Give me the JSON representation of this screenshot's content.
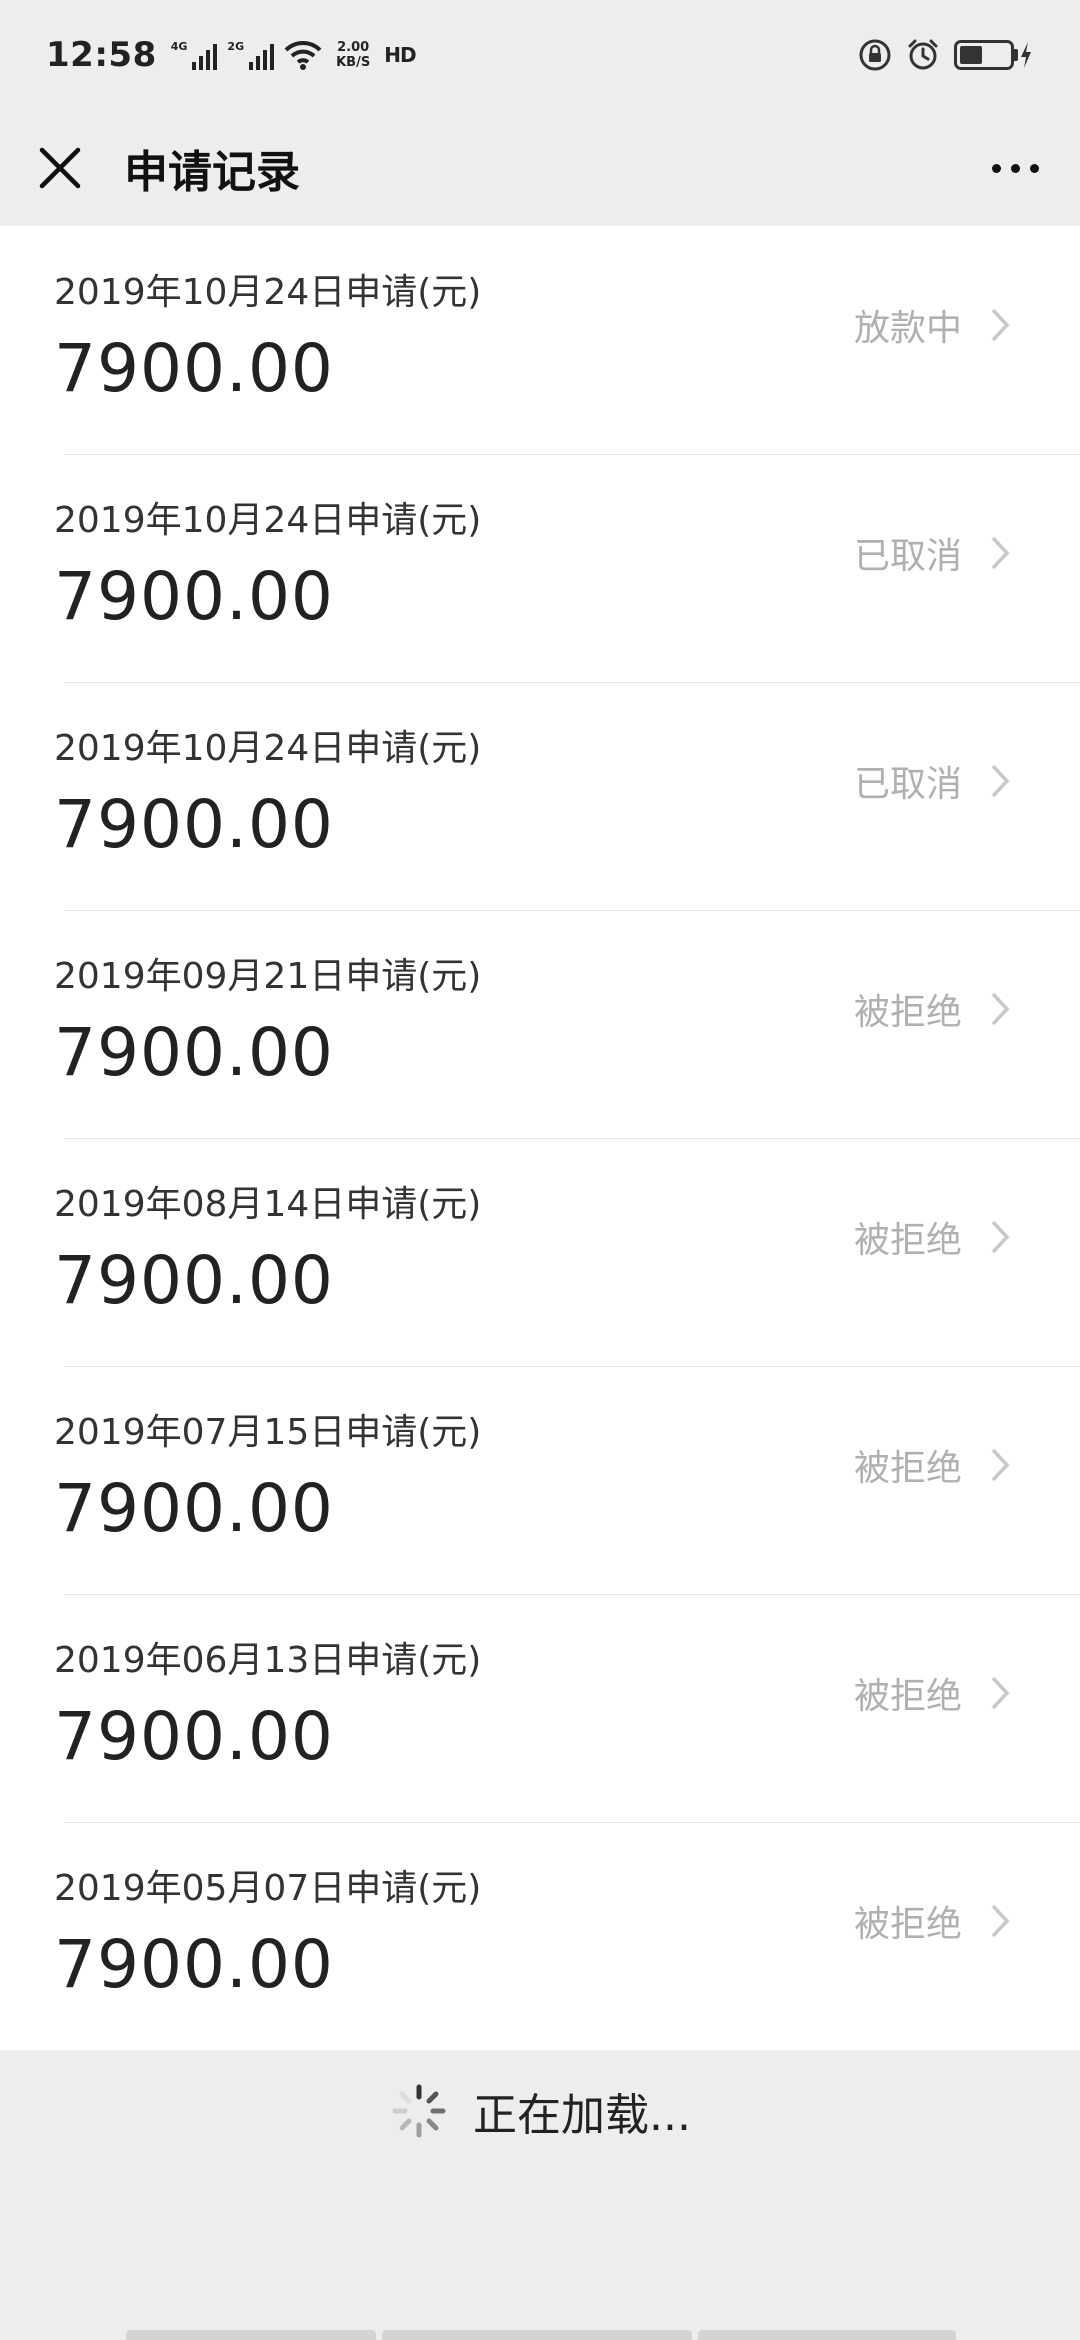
{
  "status_bar": {
    "time": "12:58",
    "signal_1_label": "4G",
    "signal_2_label": "2G",
    "speed_value": "2.00",
    "speed_unit": "KB/S",
    "hd_label": "HD",
    "battery_level": 0.45
  },
  "nav": {
    "title": "申请记录"
  },
  "records": [
    {
      "date": "2019年10月24日申请(元)",
      "amount": "7900.00",
      "status": "放款中"
    },
    {
      "date": "2019年10月24日申请(元)",
      "amount": "7900.00",
      "status": "已取消"
    },
    {
      "date": "2019年10月24日申请(元)",
      "amount": "7900.00",
      "status": "已取消"
    },
    {
      "date": "2019年09月21日申请(元)",
      "amount": "7900.00",
      "status": "被拒绝"
    },
    {
      "date": "2019年08月14日申请(元)",
      "amount": "7900.00",
      "status": "被拒绝"
    },
    {
      "date": "2019年07月15日申请(元)",
      "amount": "7900.00",
      "status": "被拒绝"
    },
    {
      "date": "2019年06月13日申请(元)",
      "amount": "7900.00",
      "status": "被拒绝"
    },
    {
      "date": "2019年05月07日申请(元)",
      "amount": "7900.00",
      "status": "被拒绝"
    }
  ],
  "loading": {
    "text": "正在加载..."
  },
  "icons": {
    "close": "close-icon",
    "more": "more-icon",
    "chevron": "chevron-right-icon",
    "spinner": "loading-spinner-icon",
    "lock": "rotation-lock-icon",
    "alarm": "alarm-icon",
    "wifi": "wifi-icon",
    "battery": "battery-icon"
  }
}
